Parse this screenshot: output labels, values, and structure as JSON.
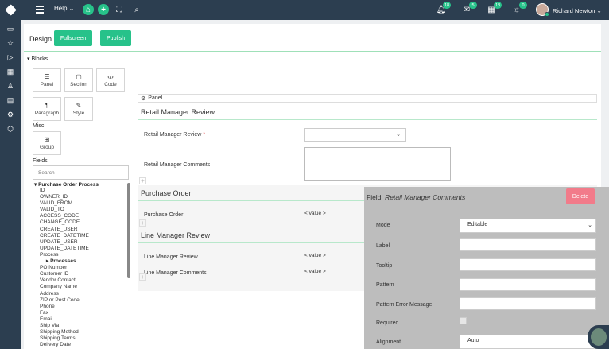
{
  "topbar": {
    "help_label": "Help",
    "user_name": "Richard Newton",
    "badges": {
      "notifications": "18",
      "messages": "5",
      "calendar": "18",
      "sun": "0"
    }
  },
  "toolbar": {
    "title": "Design",
    "fullscreen_label": "Fullscreen",
    "publish_label": "Publish"
  },
  "blocks": {
    "title": "Blocks",
    "items": [
      {
        "label": "Panel",
        "icon": "list-icon"
      },
      {
        "label": "Section",
        "icon": "square-icon"
      },
      {
        "label": "Code",
        "icon": "code-icon"
      },
      {
        "label": "Paragraph",
        "icon": "paragraph-icon"
      },
      {
        "label": "Style",
        "icon": "style-icon"
      }
    ],
    "misc_title": "Misc",
    "group_label": "Group"
  },
  "fields": {
    "title": "Fields",
    "search_placeholder": "Search",
    "root": "Purchase Order Process",
    "items": [
      "ID",
      "OWNER_ID",
      "VALID_FROM",
      "VALID_TO",
      "ACCESS_CODE",
      "CHANGE_CODE",
      "CREATE_USER",
      "CREATE_DATETIME",
      "UPDATE_USER",
      "UPDATE_DATETIME",
      "Process"
    ],
    "subgroup": "Processes",
    "items2": [
      "PO Number",
      "Customer ID",
      "Vendor Contact",
      "Company Name",
      "Address",
      "ZIP or Post Code",
      "Phone",
      "Fax",
      "Email",
      "Ship Via",
      "Shipping Method",
      "Shipping Terms",
      "Delivery Date"
    ]
  },
  "canvas": {
    "panel_label": "Panel",
    "sections": [
      {
        "title": "Retail Manager Review",
        "fields": [
          "Retail Manager Review",
          "Retail Manager Comments"
        ]
      },
      {
        "title": "Purchase Order",
        "fields": [
          "Purchase Order"
        ]
      },
      {
        "title": "Line Manager Review",
        "fields": [
          "Line Manager Review",
          "Line Manager Comments"
        ]
      }
    ],
    "value_placeholder": "< value >",
    "required_mark": "*"
  },
  "properties": {
    "title_prefix": "Field:",
    "title_field": "Retail Manager Comments",
    "delete_label": "Delete",
    "labels": [
      "Mode",
      "Label",
      "Tooltip",
      "Pattern",
      "Pattern Error Message",
      "Required",
      "Alignment"
    ],
    "mode_value": "Editable",
    "alignment_value": "Auto"
  },
  "colors": {
    "accent": "#27c28a",
    "nav": "#2c3e50",
    "danger": "#f27b8a"
  }
}
